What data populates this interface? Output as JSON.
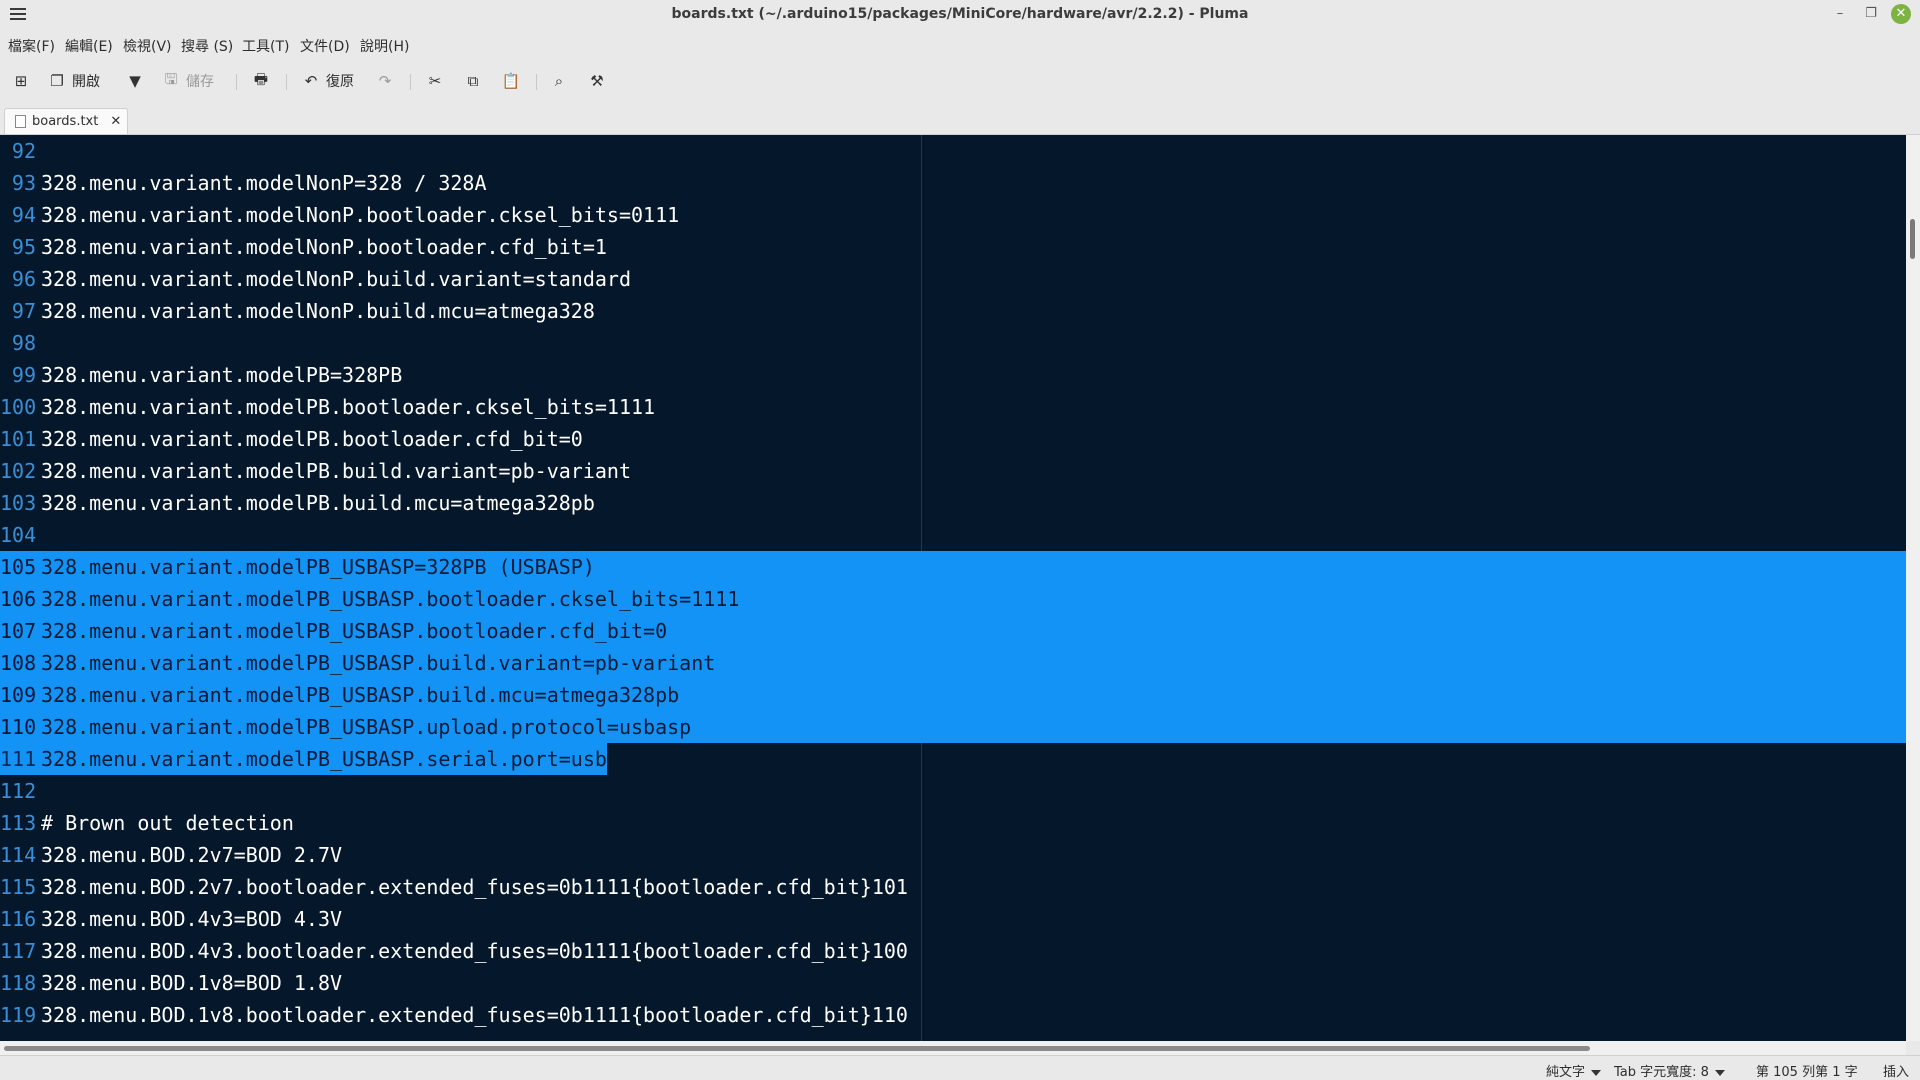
{
  "window": {
    "title": "boards.txt (~/.arduino15/packages/MiniCore/hardware/avr/2.2.2) - Pluma"
  },
  "menubar": {
    "items": [
      "檔案(F)",
      "編輯(E)",
      "檢視(V)",
      "搜尋 (S)",
      "工具(T)",
      "文件(D)",
      "說明(H)"
    ]
  },
  "toolbar": {
    "open_label": "開啟",
    "save_label": "儲存",
    "undo_label": "復原"
  },
  "tab": {
    "name": "boards.txt",
    "close": "✕"
  },
  "editor": {
    "lines": [
      {
        "num": "92",
        "text": ""
      },
      {
        "num": "93",
        "text": "328.menu.variant.modelNonP=328 / 328A"
      },
      {
        "num": "94",
        "text": "328.menu.variant.modelNonP.bootloader.cksel_bits=0111"
      },
      {
        "num": "95",
        "text": "328.menu.variant.modelNonP.bootloader.cfd_bit=1"
      },
      {
        "num": "96",
        "text": "328.menu.variant.modelNonP.build.variant=standard"
      },
      {
        "num": "97",
        "text": "328.menu.variant.modelNonP.build.mcu=atmega328"
      },
      {
        "num": "98",
        "text": ""
      },
      {
        "num": "99",
        "text": "328.menu.variant.modelPB=328PB"
      },
      {
        "num": "100",
        "text": "328.menu.variant.modelPB.bootloader.cksel_bits=1111"
      },
      {
        "num": "101",
        "text": "328.menu.variant.modelPB.bootloader.cfd_bit=0"
      },
      {
        "num": "102",
        "text": "328.menu.variant.modelPB.build.variant=pb-variant"
      },
      {
        "num": "103",
        "text": "328.menu.variant.modelPB.build.mcu=atmega328pb"
      },
      {
        "num": "104",
        "text": ""
      },
      {
        "num": "105",
        "text": "328.menu.variant.modelPB_USBASP=328PB (USBASP)"
      },
      {
        "num": "106",
        "text": "328.menu.variant.modelPB_USBASP.bootloader.cksel_bits=1111"
      },
      {
        "num": "107",
        "text": "328.menu.variant.modelPB_USBASP.bootloader.cfd_bit=0"
      },
      {
        "num": "108",
        "text": "328.menu.variant.modelPB_USBASP.build.variant=pb-variant"
      },
      {
        "num": "109",
        "text": "328.menu.variant.modelPB_USBASP.build.mcu=atmega328pb"
      },
      {
        "num": "110",
        "text": "328.menu.variant.modelPB_USBASP.upload.protocol=usbasp"
      },
      {
        "num": "111",
        "text": "328.menu.variant.modelPB_USBASP.serial.port=usb"
      },
      {
        "num": "112",
        "text": ""
      },
      {
        "num": "113",
        "text": "# Brown out detection"
      },
      {
        "num": "114",
        "text": "328.menu.BOD.2v7=BOD 2.7V"
      },
      {
        "num": "115",
        "text": "328.menu.BOD.2v7.bootloader.extended_fuses=0b1111{bootloader.cfd_bit}101"
      },
      {
        "num": "116",
        "text": "328.menu.BOD.4v3=BOD 4.3V"
      },
      {
        "num": "117",
        "text": "328.menu.BOD.4v3.bootloader.extended_fuses=0b1111{bootloader.cfd_bit}100"
      },
      {
        "num": "118",
        "text": "328.menu.BOD.1v8=BOD 1.8V"
      },
      {
        "num": "119",
        "text": "328.menu.BOD.1v8.bootloader.extended_fuses=0b1111{bootloader.cfd_bit}110"
      }
    ],
    "selection": {
      "from_line": "105",
      "to_line": "111"
    }
  },
  "statusbar": {
    "language": "純文字",
    "tab_width": "Tab 字元寬度: 8",
    "position": "第 105 列第 1 字",
    "mode": "插入"
  },
  "colors": {
    "editor_bg": "#05172b",
    "selection": "#1293f5",
    "line_number": "#3b8fd6",
    "close_button": "#7cb342"
  }
}
